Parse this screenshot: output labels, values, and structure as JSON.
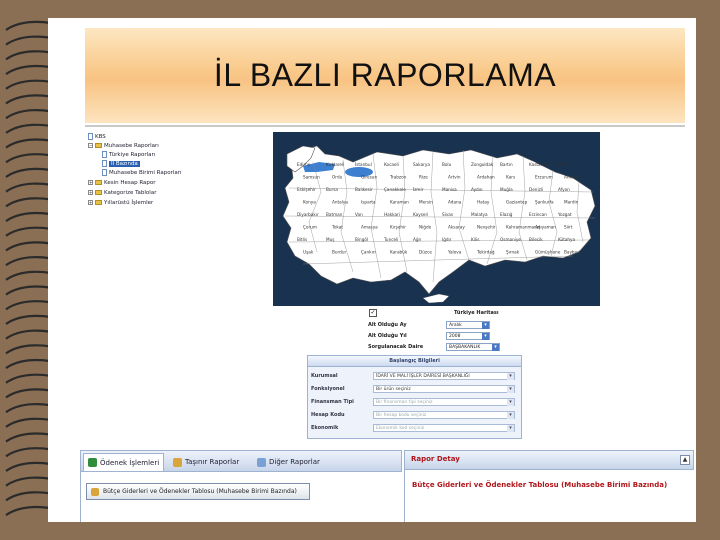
{
  "slide": {
    "title": "İL BAZLI RAPORLAMA",
    "colors": {
      "frame": "#8a6f55",
      "title_band": "#f8c383",
      "accent_red": "#b0161a"
    }
  },
  "tree": {
    "items": [
      {
        "label": "KBS",
        "icon": "root-icon"
      },
      {
        "label": "Muhasebe Raporları",
        "icon": "folder-icon"
      },
      {
        "label": "Türkiye Raporları",
        "icon": "document-icon"
      },
      {
        "label": "İl Bazında",
        "icon": "document-icon",
        "selected": true
      },
      {
        "label": "Muhasebe Birimi Raporları",
        "icon": "document-icon"
      },
      {
        "label": "Kesin Hesap Rapor",
        "icon": "folder-icon"
      },
      {
        "label": "Kategorize Tablolar",
        "icon": "folder-icon"
      },
      {
        "label": "Yıllarüstü İşlemler",
        "icon": "folder-icon"
      }
    ]
  },
  "map": {
    "cities": [
      "Edirne",
      "Kırklareli",
      "İstanbul",
      "Kocaeli",
      "Sakarya",
      "Bolu",
      "Zonguldak",
      "Bartın",
      "Kastamonu",
      "Sinop",
      "Samsun",
      "Ordu",
      "Giresun",
      "Trabzon",
      "Rize",
      "Artvin",
      "Ardahan",
      "Kars",
      "Erzurum",
      "Ankara",
      "Eskişehir",
      "Bursa",
      "Balıkesir",
      "Çanakkale",
      "İzmir",
      "Manisa",
      "Aydın",
      "Muğla",
      "Denizli",
      "Afyon",
      "Konya",
      "Antalya",
      "Isparta",
      "Karaman",
      "Mersin",
      "Adana",
      "Hatay",
      "Gaziantep",
      "Şanlıurfa",
      "Mardin",
      "Diyarbakır",
      "Batman",
      "Van",
      "Hakkari",
      "Kayseri",
      "Sivas",
      "Malatya",
      "Elazığ",
      "Erzincan",
      "Yozgat",
      "Çorum",
      "Tokat",
      "Amasya",
      "Kırşehir",
      "Niğde",
      "Aksaray",
      "Nevşehir",
      "Kahramanmaraş",
      "Adıyaman",
      "Siirt",
      "Bitlis",
      "Muş",
      "Bingöl",
      "Tunceli",
      "Ağrı",
      "Iğdır",
      "Kilis",
      "Osmaniye",
      "Bilecik",
      "Kütahya",
      "Uşak",
      "Burdur",
      "Çankırı",
      "Karabük",
      "Düzce",
      "Yalova",
      "Tekirdağ",
      "Şırnak",
      "Gümüşhane",
      "Bayburt"
    ]
  },
  "form": {
    "checkbox_checked": true,
    "checkbox_mark": "✓",
    "map_label": "Türkiye Haritası",
    "rows": [
      {
        "label": "Alt Olduğu Ay",
        "value": "Aralık"
      },
      {
        "label": "Alt Olduğu Yıl",
        "value": "2008"
      },
      {
        "label": "Sorgulanacak Daire",
        "value": "BAŞBAKANLIK"
      }
    ]
  },
  "panel": {
    "title": "Başlangıç Bilgileri",
    "rows": [
      {
        "label": "Kurumsal",
        "value": "İDARİ VE MALİ İŞLER DAİRESİ BAŞKANLIĞI",
        "dim": false
      },
      {
        "label": "Fonksiyonel",
        "value": "Bir ürün seçiniz",
        "dim": false
      },
      {
        "label": "Finansman Tipi",
        "value": "Bir finansman tipi seçiniz",
        "dim": true
      },
      {
        "label": "Hesap Kodu",
        "value": "Bir hesap kodu seçiniz",
        "dim": true
      },
      {
        "label": "Ekonomik",
        "value": "Ekonomik kod seçiniz",
        "dim": true
      }
    ]
  },
  "tabs": [
    {
      "label": "Ödenek İşlemleri",
      "icon": "money-icon",
      "active": true
    },
    {
      "label": "Taşınır Raporlar",
      "icon": "box-icon",
      "active": false
    },
    {
      "label": "Diğer Raporlar",
      "icon": "report-icon",
      "active": false
    }
  ],
  "report_button": {
    "label": "Bütçe Giderleri ve Ödenekler Tablosu (Muhasebe Birimi Bazında)",
    "icon": "report-icon"
  },
  "detail": {
    "title": "Rapor Detay",
    "collapse_icon": "chevron-up-icon",
    "collapse_glyph": "▲",
    "report_title": "Bütçe Giderleri ve Ödenekler Tablosu (Muhasebe Birimi Bazında)"
  }
}
